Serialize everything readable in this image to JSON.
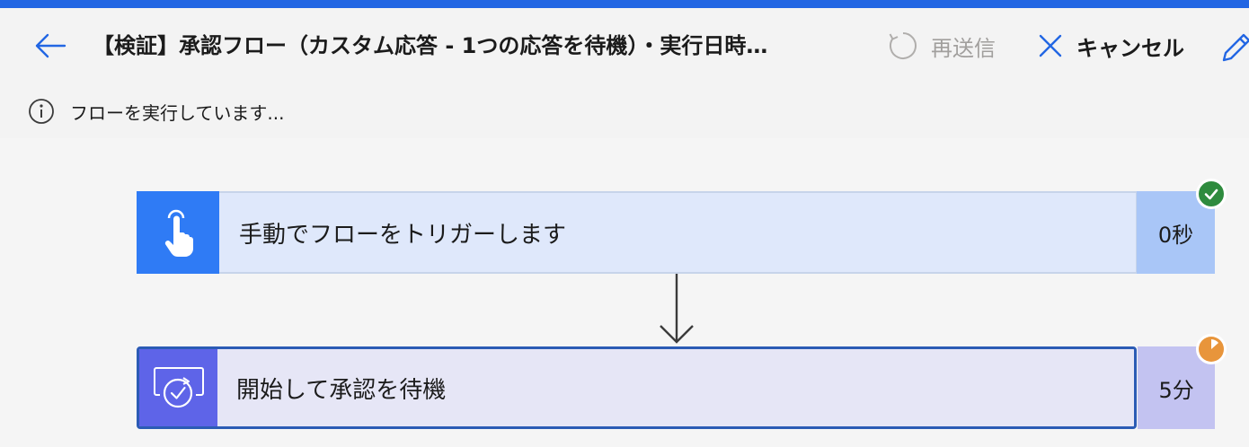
{
  "header": {
    "title": "【検証】承認フロー（カスタム応答 - 1つの応答を待機）・実行日時…",
    "resend_label": "再送信",
    "cancel_label": "キャンセル",
    "status_message": "フローを実行しています..."
  },
  "flow": {
    "steps": [
      {
        "label": "手動でフローをトリガーします",
        "duration": "0秒",
        "status": "succeeded",
        "icon": "touch-hand-icon"
      },
      {
        "label": "開始して承認を待機",
        "duration": "5分",
        "status": "running",
        "icon": "approval-icon"
      }
    ]
  },
  "colors": {
    "accent": "#2266e3",
    "trigger_icon_bg": "#2f7bf5",
    "approval_icon_bg": "#5e64e8",
    "success": "#2e8b3e",
    "pending": "#e8953b"
  }
}
